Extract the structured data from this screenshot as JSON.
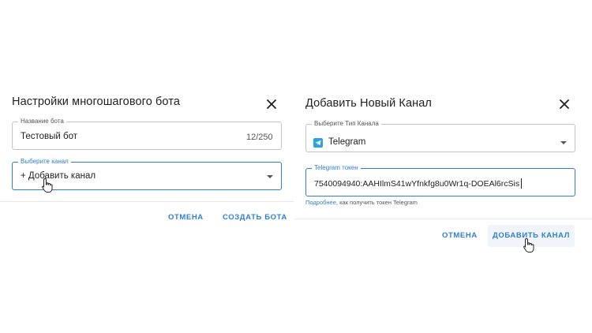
{
  "left_dialog": {
    "title": "Настройки многошагового бота",
    "bot_name_field": {
      "label": "Название бота",
      "value": "Тестовый бот",
      "counter": "12/250"
    },
    "channel_field": {
      "label": "Выберите канал",
      "value": "+ Добавить канал"
    },
    "cancel_label": "ОТМЕНА",
    "create_label": "СОЗДАТЬ БОТА"
  },
  "right_dialog": {
    "title": "Добавить Новый Канал",
    "channel_type_field": {
      "label": "Выберите Тип Канала",
      "value": "Telegram",
      "icon": "telegram-icon"
    },
    "token_field": {
      "label": "Telegram токен",
      "value": "7540094940:AAHIlmS41wYfnkfg8u0Wr1q-DOEAl6rcSis"
    },
    "helper": {
      "link": "Подробнее",
      "text": ", как получить токен Telegram"
    },
    "cancel_label": "ОТМЕНА",
    "add_label": "ДОБАВИТЬ КАНАЛ"
  },
  "colors": {
    "accent": "#2f7fd6",
    "telegram": "#2aa3df",
    "border": "#c4c4c4"
  }
}
